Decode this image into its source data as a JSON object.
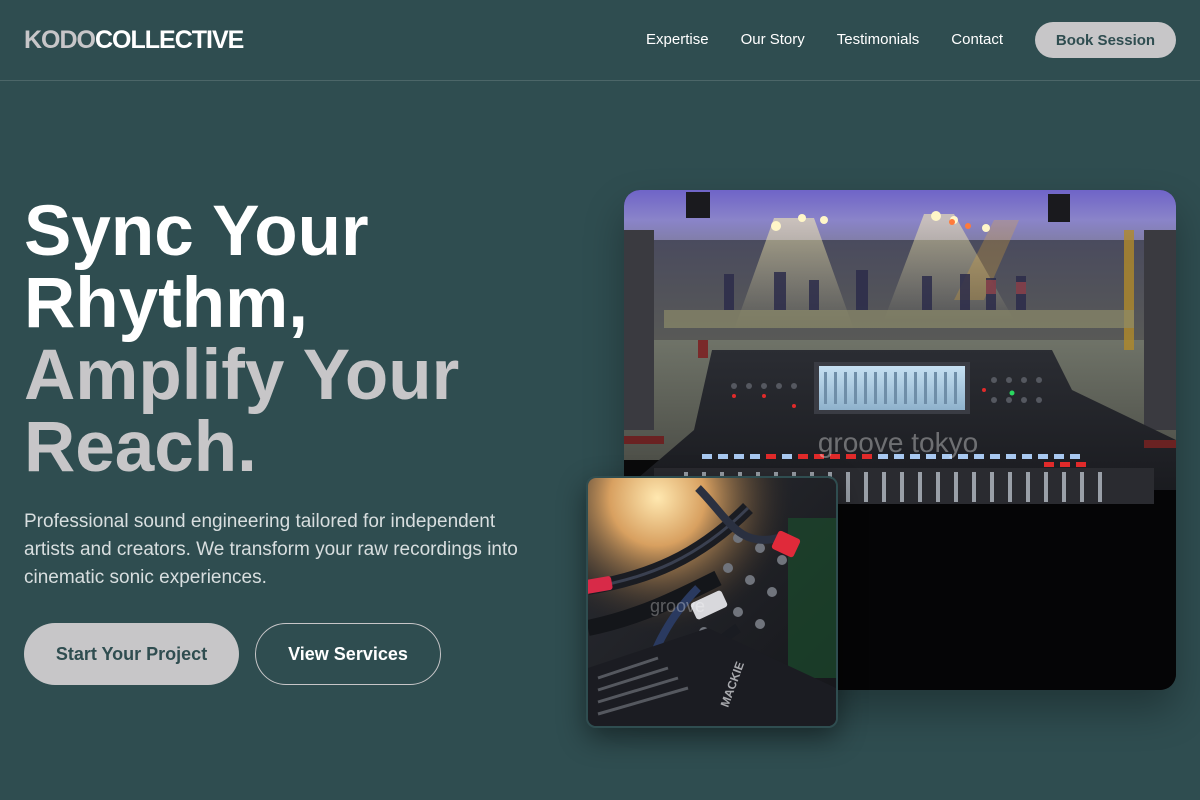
{
  "brand": {
    "part1": "KODO",
    "part2": "COLLECTIVE"
  },
  "nav": {
    "items": [
      {
        "label": "Expertise"
      },
      {
        "label": "Our Story"
      },
      {
        "label": "Testimonials"
      },
      {
        "label": "Contact"
      }
    ],
    "cta_label": "Book Session"
  },
  "hero": {
    "title_line1": "Sync Your",
    "title_line2": "Rhythm,",
    "title_line3": "Amplify Your",
    "title_line4": "Reach.",
    "description": "Professional sound engineering tailored for independent artists and creators. We transform your raw recordings into cinematic sonic experiences.",
    "primary_cta": "Start Your Project",
    "secondary_cta": "View Services"
  },
  "images": {
    "main_watermark": "groove tokyo",
    "secondary_watermark": "groove",
    "secondary_brand": "MACKIE"
  },
  "colors": {
    "background": "#2f4d50",
    "accent": "#c7c6c8",
    "text": "#ffffff"
  }
}
